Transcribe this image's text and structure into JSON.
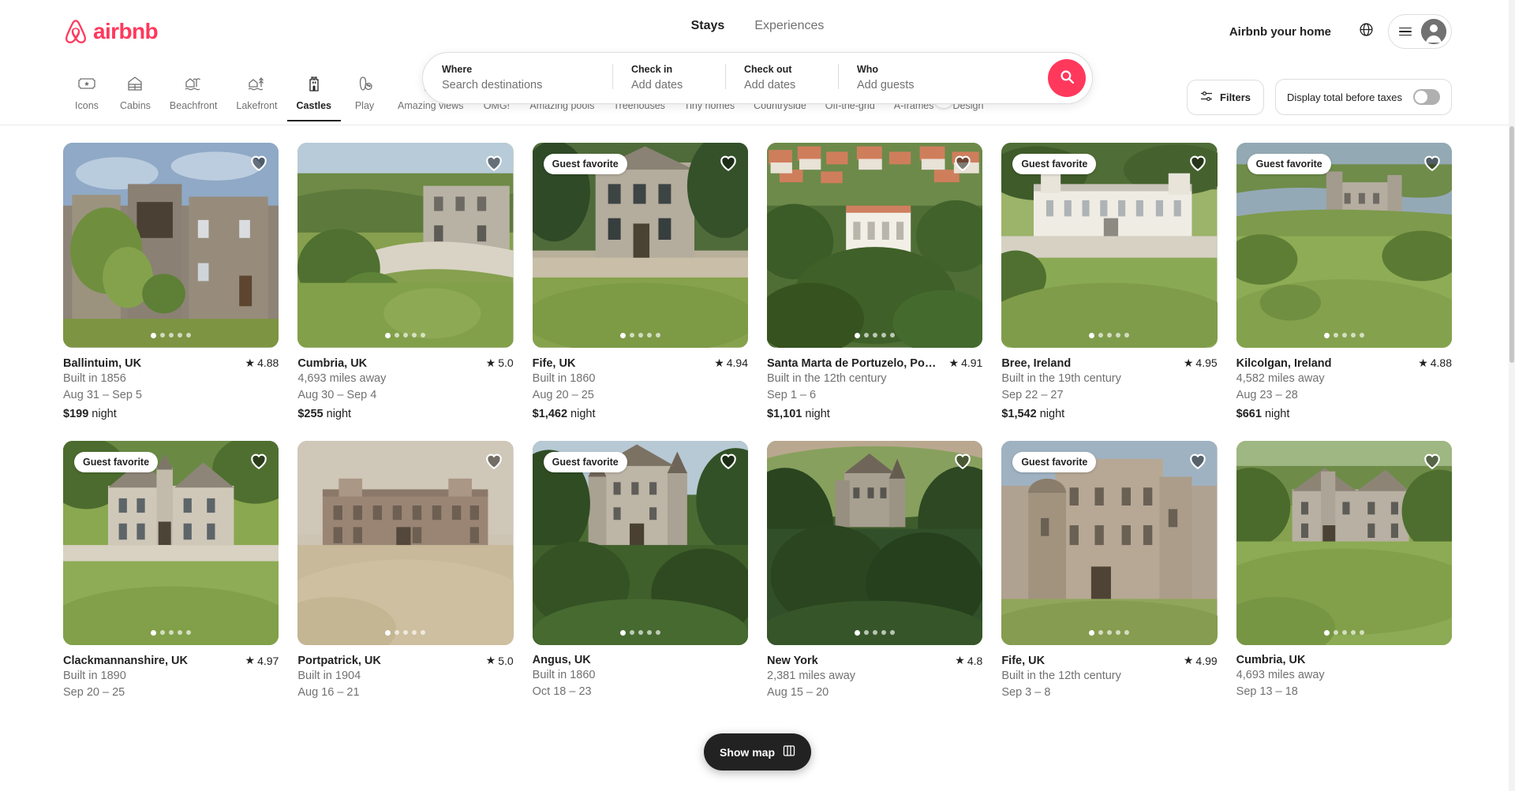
{
  "brand": {
    "name": "airbnb",
    "color": "#FF385C",
    "logo_icon": "airbnb-bel-logo"
  },
  "header": {
    "tabs": [
      {
        "label": "Stays",
        "active": true
      },
      {
        "label": "Experiences",
        "active": false
      }
    ],
    "host_link": "Airbnb your home",
    "globe_icon": "globe-icon",
    "menu_icon": "hamburger-icon",
    "avatar_icon": "user-avatar-icon"
  },
  "search": {
    "where": {
      "label": "Where",
      "placeholder": "Search destinations",
      "value": ""
    },
    "checkin": {
      "label": "Check in",
      "placeholder": "Add dates",
      "value": ""
    },
    "checkout": {
      "label": "Check out",
      "placeholder": "Add dates",
      "value": ""
    },
    "who": {
      "label": "Who",
      "placeholder": "Add guests",
      "value": ""
    },
    "search_icon": "search-icon"
  },
  "categories": [
    {
      "label": "Icons",
      "icon": "ticket-star-icon",
      "active": false
    },
    {
      "label": "Cabins",
      "icon": "cabin-icon",
      "active": false
    },
    {
      "label": "Beachfront",
      "icon": "beach-hut-icon",
      "active": false
    },
    {
      "label": "Lakefront",
      "icon": "lake-house-icon",
      "active": false
    },
    {
      "label": "Castles",
      "icon": "castle-tower-icon",
      "active": true
    },
    {
      "label": "Play",
      "icon": "bowling-icon",
      "active": false
    },
    {
      "label": "Amazing views",
      "icon": "framed-view-icon",
      "active": false
    },
    {
      "label": "OMG!",
      "icon": "ufo-icon",
      "active": false
    },
    {
      "label": "Amazing pools",
      "icon": "pool-icon",
      "active": false
    },
    {
      "label": "Treehouses",
      "icon": "treehouse-icon",
      "active": false
    },
    {
      "label": "Tiny homes",
      "icon": "tiny-home-icon",
      "active": false
    },
    {
      "label": "Countryside",
      "icon": "countryside-icon",
      "active": false
    },
    {
      "label": "Off-the-grid",
      "icon": "off-grid-icon",
      "active": false
    },
    {
      "label": "A-frames",
      "icon": "a-frame-icon",
      "active": false
    },
    {
      "label": "Design",
      "icon": "design-icon",
      "active": false
    }
  ],
  "controls": {
    "next_icon": "chevron-right-icon",
    "filters_label": "Filters",
    "filters_icon": "sliders-icon",
    "taxes_label": "Display total before taxes",
    "taxes_on": false
  },
  "listings": [
    {
      "title": "Ballintuim, UK",
      "sub1": "Built in 1856",
      "sub2": "Aug 31 – Sep 5",
      "price": "$199",
      "price_unit": "night",
      "rating": "4.88",
      "badge": "",
      "photo": "castle-stone-ivy",
      "dots": 5,
      "dot_active": 0
    },
    {
      "title": "Cumbria, UK",
      "sub1": "4,693 miles away",
      "sub2": "Aug 30 – Sep 4",
      "price": "$255",
      "price_unit": "night",
      "rating": "5.0",
      "badge": "",
      "photo": "castle-aerial-green",
      "dots": 5,
      "dot_active": 0
    },
    {
      "title": "Fife, UK",
      "sub1": "Built in 1860",
      "sub2": "Aug 20 – 25",
      "price": "$1,462",
      "price_unit": "night",
      "rating": "4.94",
      "badge": "Guest favorite",
      "photo": "castle-manor-trees",
      "dots": 5,
      "dot_active": 0
    },
    {
      "title": "Santa Marta de Portuzelo, Po…",
      "sub1": "Built in the 12th century",
      "sub2": "Sep 1 – 6",
      "price": "$1,101",
      "price_unit": "night",
      "rating": "4.91",
      "badge": "",
      "photo": "white-palace-village",
      "dots": 5,
      "dot_active": 0
    },
    {
      "title": "Bree, Ireland",
      "sub1": "Built in the 19th century",
      "sub2": "Sep 22 – 27",
      "price": "$1,542",
      "price_unit": "night",
      "rating": "4.95",
      "badge": "Guest favorite",
      "photo": "white-castle-lawn",
      "dots": 5,
      "dot_active": 0
    },
    {
      "title": "Kilcolgan, Ireland",
      "sub1": "4,582 miles away",
      "sub2": "Aug 23 – 28",
      "price": "$661",
      "price_unit": "night",
      "rating": "4.88",
      "badge": "Guest favorite",
      "photo": "lakeside-castle",
      "dots": 5,
      "dot_active": 0
    },
    {
      "title": "Clackmannanshire, UK",
      "sub1": "Built in 1890",
      "sub2": "Sep 20 – 25",
      "price": "",
      "price_unit": "",
      "rating": "4.97",
      "badge": "Guest favorite",
      "photo": "baronial-mansion",
      "dots": 5,
      "dot_active": 0
    },
    {
      "title": "Portpatrick, UK",
      "sub1": "Built in 1904",
      "sub2": "Aug 16 – 21",
      "price": "",
      "price_unit": "",
      "rating": "5.0",
      "badge": "",
      "photo": "sandstone-manor",
      "dots": 5,
      "dot_active": 0
    },
    {
      "title": "Angus, UK",
      "sub1": "Built in 1860",
      "sub2": "Oct 18 – 23",
      "price": "",
      "price_unit": "",
      "rating": "",
      "badge": "Guest favorite",
      "photo": "turreted-castle",
      "dots": 5,
      "dot_active": 0
    },
    {
      "title": "New York",
      "sub1": "2,381 miles away",
      "sub2": "Aug 15 – 20",
      "price": "",
      "price_unit": "",
      "rating": "4.8",
      "badge": "",
      "photo": "hilltop-castle-forest",
      "dots": 5,
      "dot_active": 0
    },
    {
      "title": "Fife, UK",
      "sub1": "Built in the 12th century",
      "sub2": "Sep 3 – 8",
      "price": "",
      "price_unit": "",
      "rating": "4.99",
      "badge": "Guest favorite",
      "photo": "stone-keep-round-tower",
      "dots": 5,
      "dot_active": 0
    },
    {
      "title": "Cumbria, UK",
      "sub1": "4,693 miles away",
      "sub2": "Sep 13 – 18",
      "price": "",
      "price_unit": "",
      "rating": "",
      "badge": "",
      "photo": "castle-aerial-green-2",
      "dots": 5,
      "dot_active": 0
    }
  ],
  "footer": {
    "show_map_label": "Show map",
    "show_map_icon": "map-icon"
  }
}
